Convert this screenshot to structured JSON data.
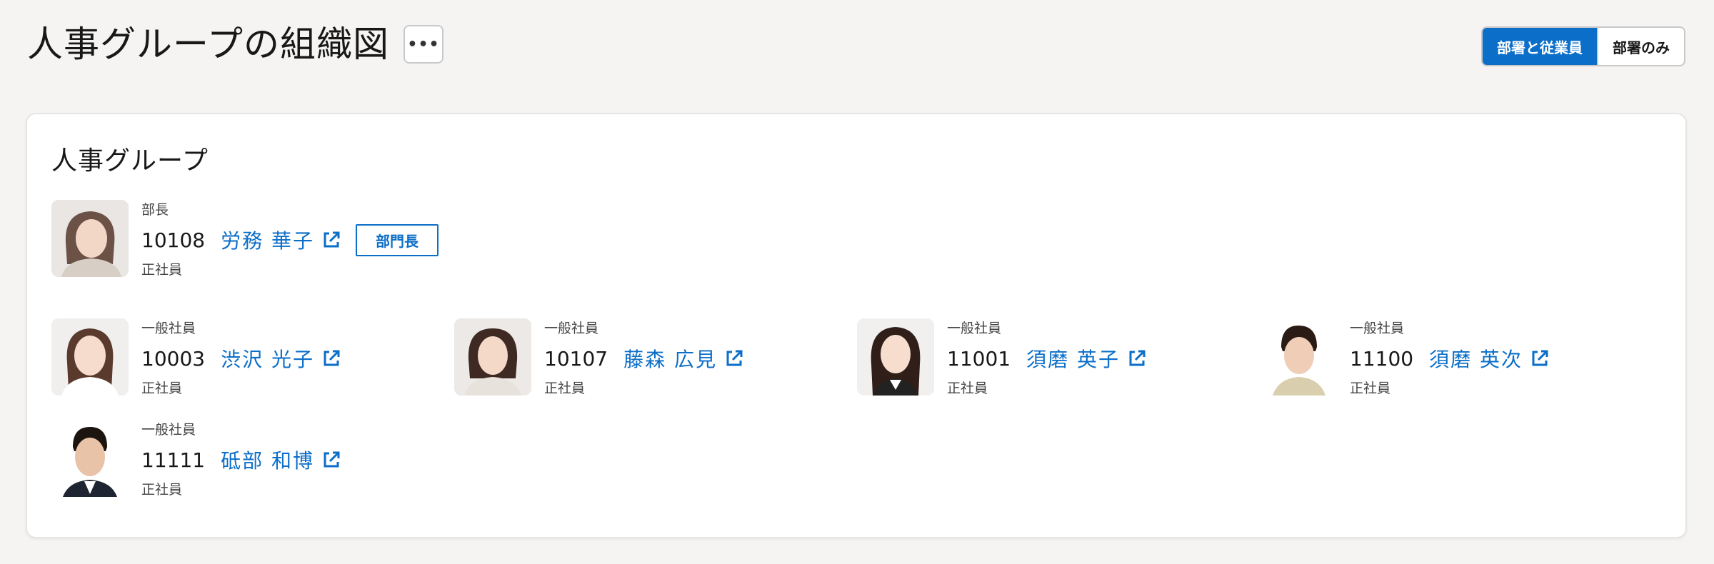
{
  "header": {
    "title": "人事グループの組織図",
    "more_label": "•••"
  },
  "view_toggle": {
    "options": [
      "部署と従業員",
      "部署のみ"
    ],
    "selected": "部署と従業員"
  },
  "colors": {
    "accent": "#0b6ec8"
  },
  "department": {
    "name": "人事グループ",
    "head": {
      "role": "部長",
      "emp_no": "10108",
      "name": "労務 華子",
      "emp_type": "正社員",
      "badge": "部門長",
      "icon": "external-link-icon"
    },
    "members": [
      {
        "role": "一般社員",
        "emp_no": "10003",
        "name": "渋沢 光子",
        "emp_type": "正社員"
      },
      {
        "role": "一般社員",
        "emp_no": "10107",
        "name": "藤森 広見",
        "emp_type": "正社員"
      },
      {
        "role": "一般社員",
        "emp_no": "11001",
        "name": "須磨 英子",
        "emp_type": "正社員"
      },
      {
        "role": "一般社員",
        "emp_no": "11100",
        "name": "須磨 英次",
        "emp_type": "正社員"
      },
      {
        "role": "一般社員",
        "emp_no": "11111",
        "name": "砥部 和博",
        "emp_type": "正社員"
      }
    ]
  }
}
